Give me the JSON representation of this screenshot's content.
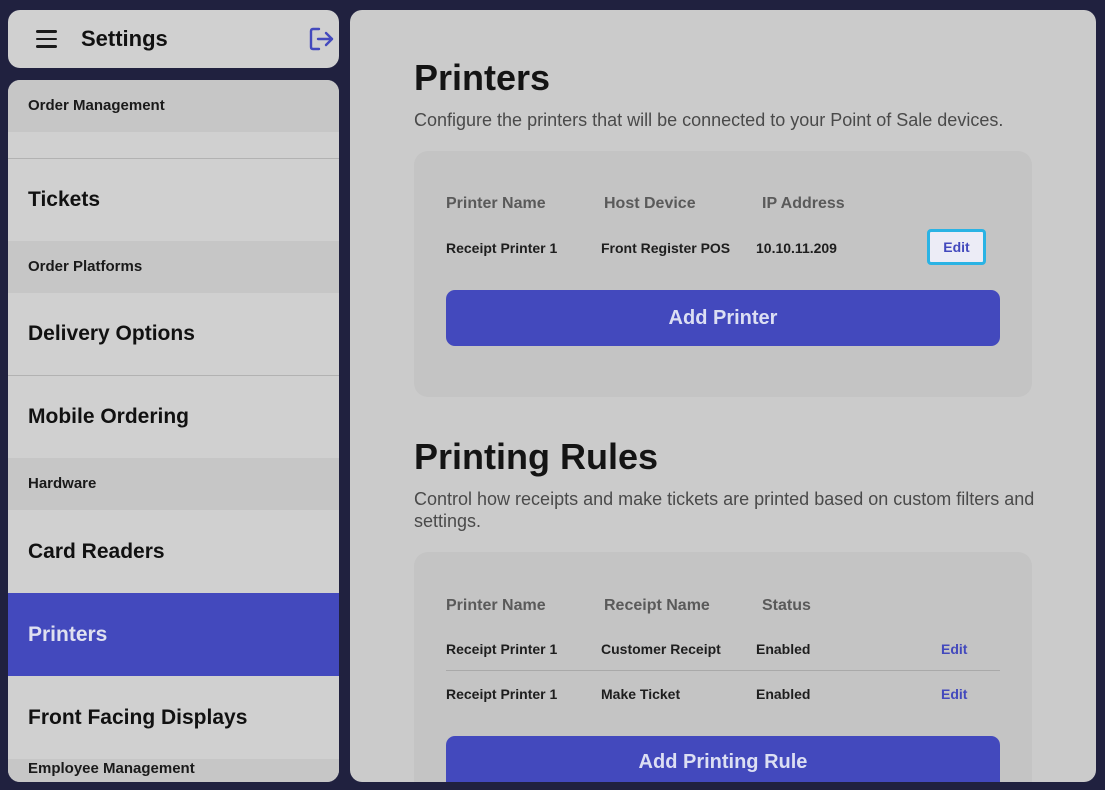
{
  "header": {
    "title": "Settings"
  },
  "sidebar": {
    "sections": [
      {
        "label": "Order Management"
      },
      {
        "label": "Order Platforms"
      },
      {
        "label": "Hardware"
      },
      {
        "label": "Employee Management"
      }
    ],
    "items": [
      {
        "label": "Tickets"
      },
      {
        "label": "Delivery Options"
      },
      {
        "label": "Mobile Ordering"
      },
      {
        "label": "Card Readers"
      },
      {
        "label": "Printers",
        "active": true
      },
      {
        "label": "Front Facing Displays"
      }
    ]
  },
  "printers": {
    "title": "Printers",
    "description": "Configure the printers that will be connected to your Point of Sale devices.",
    "columns": [
      "Printer Name",
      "Host Device",
      "IP Address"
    ],
    "rows": [
      {
        "name": "Receipt Printer 1",
        "host": "Front Register POS",
        "ip": "10.10.11.209",
        "action": "Edit"
      }
    ],
    "add_label": "Add Printer"
  },
  "rules": {
    "title": "Printing Rules",
    "description": "Control how receipts and make tickets are printed based on custom filters and settings.",
    "columns": [
      "Printer Name",
      "Receipt Name",
      "Status"
    ],
    "rows": [
      {
        "printer": "Receipt Printer 1",
        "receipt": "Customer Receipt",
        "status": "Enabled",
        "action": "Edit"
      },
      {
        "printer": "Receipt Printer 1",
        "receipt": "Make Ticket",
        "status": "Enabled",
        "action": "Edit"
      }
    ],
    "add_label": "Add Printing Rule"
  },
  "colors": {
    "accent": "#4349bd",
    "focus_ring": "#2ab3e4",
    "panel": "#d0d0d0",
    "frame": "#20213f"
  }
}
